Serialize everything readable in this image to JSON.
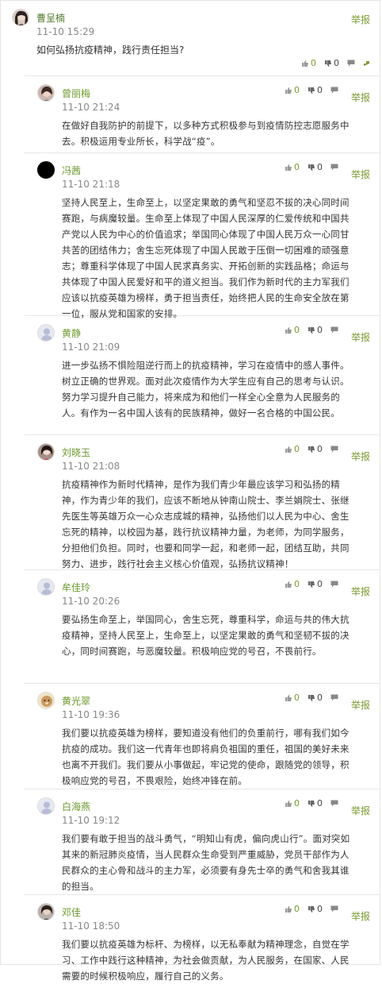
{
  "post": {
    "author": "曹呈楠",
    "time": "11-10 15:29",
    "text": "如何弘扬抗疫精神，践行责任担当?",
    "likes": "0",
    "dislikes": "0",
    "report": "举报"
  },
  "replies": [
    {
      "author": "曾丽梅",
      "time": "11-10 21:24",
      "likes": "0",
      "dislikes": "0",
      "report": "举报",
      "text": "在做好自我防护的前提下，以多种方式积极参与到疫情防控志愿服务中去。积极运用专业所长，科学战“疫”。"
    },
    {
      "author": "冯茜",
      "time": "11-10 21:18",
      "likes": "0",
      "dislikes": "0",
      "report": "举报",
      "text": "坚持人民至上，生命至上，以坚定果敢的勇气和坚忍不拔的决心同时间赛跑，与病魔较量。生命至上体现了中国人民深厚的仁爱传统和中国共产党以人民为中心的价值追求；举国同心体现了中国人民万众一心同甘共苦的团结伟力；舍生忘死体现了中国人民敢于压倒一切困难的顽强意志；尊重科学体现了中国人民求真务实、开拓创新的实践品格；命运与共体现了中国人民爱好和平的道义担当。我们作为新时代的主力军我们应该以抗疫英雄为榜样，勇于担当责任，始终把人民的生命安全放在第一位，服从党和国家的安排。"
    },
    {
      "author": "黄静",
      "time": "11-10 21:09",
      "likes": "0",
      "dislikes": "0",
      "report": "举报",
      "text": "进一步弘扬不惧险阻逆行而上的抗疫精神，学习在疫情中的感人事件。树立正确的世界观。面对此次疫情作为大学生应有自己的思考与认识。努力学习提升自己能力，将来成为和他们一样全心全意为人民服务的人。有作为一名中国人该有的民族精神，做好一名合格的中国公民。"
    },
    {
      "author": "刘晓玉",
      "time": "11-10 21:08",
      "likes": "0",
      "dislikes": "0",
      "report": "举报",
      "text": "抗疫精神作为新时代精神，是作为我们青少年最应该学习和弘扬的精神，作为青少年的我们，应该不断地从钟南山院士、李兰娟院士、张继先医生等英雄万众一心众志成城的精神，弘扬他们以人民为中心、舍生忘死的精神，以校园为基，践行抗议精神力量，为老师，为同学服务，分担他们负担。同时，也要和同学一起，和老师一起，团结互助，共同努力、进步，践行社会主义核心价值观，弘扬抗议精神！"
    },
    {
      "author": "牟佳玲",
      "time": "11-10 20:26",
      "likes": "0",
      "dislikes": "0",
      "report": "举报",
      "text": "要弘扬生命至上，举国同心，舍生忘死，尊重科学，命运与共的伟大抗疫精神，坚持人民至上，生命至上，以坚定果敢的勇气和坚韧不拔的决心，同时间赛跑，与恶魔较量。积极响应党的号召，不畏前行。"
    },
    {
      "author": "黄光翠",
      "time": "11-10 19:36",
      "likes": "0",
      "dislikes": "0",
      "report": "举报",
      "text": "我们要以抗疫英雄为榜样，要知道没有他们的负重前行，哪有我们如今抗疫的成功。我们这一代青年也即将肩负祖国的重任，祖国的美好未来也离不开我们。我们要从小事做起，牢记党的使命，跟随党的领导，积极响应党的号召，不畏艰险，始终冲锋在前。"
    },
    {
      "author": "白海燕",
      "time": "11-10 19:12",
      "likes": "0",
      "dislikes": "0",
      "report": "举报",
      "text": "我们要有敢于担当的战斗勇气，“明知山有虎，偏向虎山行”。面对突如其来的新冠肺炎疫情，当人民群众生命受到严重威胁，党员干部作为人民群众的主心骨和战斗的主力军，必须要有身先士卒的勇气和舍我其谁的担当。"
    },
    {
      "author": "邓佳",
      "time": "11-10 18:50",
      "likes": "0",
      "dislikes": "0",
      "report": "举报",
      "text": "我们要以抗疫英雄为标杆、为榜样，以无私奉献为精神理念，自觉在学习、工作中践行这种精神，为社会做贡献，为人民服务，在国家、人民需要的时候积极响应，履行自己的义务。"
    }
  ]
}
